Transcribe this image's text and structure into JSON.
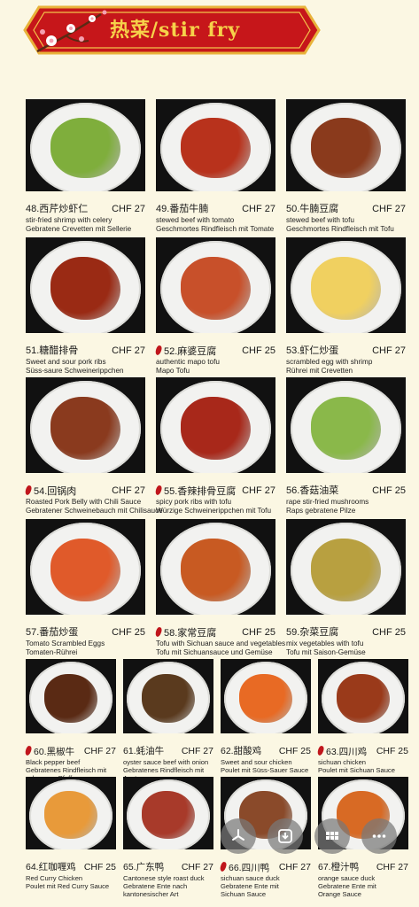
{
  "header": {
    "title": "热菜/stir fry"
  },
  "items": [
    {
      "number_name": "48.西芹炒虾仁",
      "price": "CHF 27",
      "spicy": false,
      "desc1": "stir-fried shrimp with celery",
      "desc2": "Gebratene Crevetten mit Sellerie",
      "food_color": "#7fae3c"
    },
    {
      "number_name": "49.番茄牛腩",
      "price": "CHF 27",
      "spicy": false,
      "desc1": "stewed beef with tomato",
      "desc2": "Geschmortes Rindfleisch mit Tomate",
      "food_color": "#b8321c"
    },
    {
      "number_name": "50.牛腩豆腐",
      "price": "CHF 27",
      "spicy": false,
      "desc1": "stewed beef with tofu",
      "desc2": "Geschmortes Rindfleisch mit Tofu",
      "food_color": "#8a3a1c"
    },
    {
      "number_name": "51.糖醋排骨",
      "price": "CHF 27",
      "spicy": false,
      "desc1": "Sweet and sour pork ribs",
      "desc2": "Süss-saure Schweinerippchen",
      "food_color": "#9a2a14"
    },
    {
      "number_name": "52.麻婆豆腐",
      "price": "CHF 25",
      "spicy": true,
      "desc1": "authentic mapo tofu",
      "desc2": "Mapo Tofu",
      "food_color": "#c8502a"
    },
    {
      "number_name": "53.虾仁炒蛋",
      "price": "CHF 27",
      "spicy": false,
      "desc1": "scrambled egg with shrimp",
      "desc2": "Rührei mit Crevetten",
      "food_color": "#f0d060"
    },
    {
      "number_name": "54.回锅肉",
      "price": "CHF 27",
      "spicy": true,
      "desc1": "Roasted Pork Belly with Chili Sauce",
      "desc2": "Gebratener Schweinebauch mit Chilisauce",
      "food_color": "#8a3a1e"
    },
    {
      "number_name": "55.香辣排骨豆腐",
      "price": "CHF 27",
      "spicy": true,
      "desc1": "spicy pork ribs with tofu",
      "desc2": "Würzige Schweinerippchen mit Tofu",
      "food_color": "#a8281a"
    },
    {
      "number_name": "56.香菇油菜",
      "price": "CHF 25",
      "spicy": false,
      "desc1": "rape stir-fried mushrooms",
      "desc2": "Raps gebratene Pilze",
      "food_color": "#8ab84a"
    },
    {
      "number_name": "57.番茄炒蛋",
      "price": "CHF 25",
      "spicy": false,
      "desc1": "Tomato Scrambled Eggs",
      "desc2": "Tomaten-Rührei",
      "food_color": "#e05a2a"
    },
    {
      "number_name": "58.家常豆腐",
      "price": "CHF 25",
      "spicy": true,
      "desc1": "Tofu with Sichuan sauce and vegetables",
      "desc2": "Tofu mit Sichuansauce und Gemüse",
      "food_color": "#c85a22"
    },
    {
      "number_name": "59.杂菜豆腐",
      "price": "CHF 25",
      "spicy": false,
      "desc1": "mix vegetables with tofu",
      "desc2": "Tofu mit Saison-Gemüse",
      "food_color": "#b8a040"
    },
    {
      "number_name": "60.黑椒牛",
      "price": "CHF 27",
      "spicy": true,
      "desc1": "Black pepper beef",
      "desc2": "Gebratenes Rindfleisch mit",
      "desc3": "schwarzer  Pfeffersauce",
      "food_color": "#5a2a14"
    },
    {
      "number_name": "61.蚝油牛",
      "price": "CHF 27",
      "spicy": false,
      "desc1": "oyster sauce beef with onion",
      "desc2": "Gebratenes Rindfleisch mit",
      "desc3": "Austernsauce",
      "food_color": "#5a3a1e"
    },
    {
      "number_name": "62.甜酸鸡",
      "price": "CHF 25",
      "spicy": false,
      "desc1": "Sweet and sour chicken",
      "desc2": "Poulet mit Süss-Sauer Sauce",
      "food_color": "#e86a24"
    },
    {
      "number_name": "63.四川鸡",
      "price": "CHF 25",
      "spicy": true,
      "desc1": "sichuan chicken",
      "desc2": "Poulet mit Sichuan Sauce",
      "food_color": "#9a3a1a"
    },
    {
      "number_name": "64.红咖喱鸡",
      "price": "CHF 25",
      "spicy": false,
      "desc1": "Red Curry Chicken",
      "desc2": "Poulet mit Red Curry Sauce",
      "food_color": "#e89a3a"
    },
    {
      "number_name": "65.广东鸭",
      "price": "CHF 27",
      "spicy": false,
      "desc1": "Cantonese style roast duck",
      "desc2": "Gebratene Ente nach",
      "desc3": "kantonesischer Art",
      "food_color": "#a83a2a"
    },
    {
      "number_name": "66.四川鸭",
      "price": "CHF 27",
      "spicy": true,
      "desc1": "sichuan sauce duck",
      "desc2": "Gebratene Ente mit",
      "desc3": "Sichuan Sauce",
      "food_color": "#8a4a2a"
    },
    {
      "number_name": "67.橙汁鸭",
      "price": "CHF 27",
      "spicy": false,
      "desc1": "orange sauce duck",
      "desc2": "Gebratene Ente mit",
      "desc3": "Orange Sauce",
      "food_color": "#d86a24"
    }
  ],
  "fabs": [
    {
      "icon": "pinwheel-icon"
    },
    {
      "icon": "download-icon"
    },
    {
      "icon": "grid-icon"
    },
    {
      "icon": "more-icon"
    }
  ]
}
